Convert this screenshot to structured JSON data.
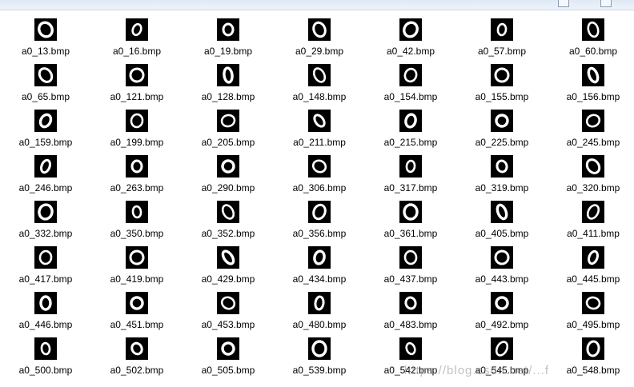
{
  "window": {
    "accent": "#dfe9f5",
    "background": "#ffffff"
  },
  "files": [
    "a0_13.bmp",
    "a0_16.bmp",
    "a0_19.bmp",
    "a0_29.bmp",
    "a0_42.bmp",
    "a0_57.bmp",
    "a0_60.bmp",
    "a0_65.bmp",
    "a0_121.bmp",
    "a0_128.bmp",
    "a0_148.bmp",
    "a0_154.bmp",
    "a0_155.bmp",
    "a0_156.bmp",
    "a0_159.bmp",
    "a0_199.bmp",
    "a0_205.bmp",
    "a0_211.bmp",
    "a0_215.bmp",
    "a0_225.bmp",
    "a0_245.bmp",
    "a0_246.bmp",
    "a0_263.bmp",
    "a0_290.bmp",
    "a0_306.bmp",
    "a0_317.bmp",
    "a0_319.bmp",
    "a0_320.bmp",
    "a0_332.bmp",
    "a0_350.bmp",
    "a0_352.bmp",
    "a0_356.bmp",
    "a0_361.bmp",
    "a0_405.bmp",
    "a0_411.bmp",
    "a0_417.bmp",
    "a0_419.bmp",
    "a0_429.bmp",
    "a0_434.bmp",
    "a0_437.bmp",
    "a0_443.bmp",
    "a0_445.bmp",
    "a0_446.bmp",
    "a0_451.bmp",
    "a0_453.bmp",
    "a0_480.bmp",
    "a0_483.bmp",
    "a0_492.bmp",
    "a0_495.bmp",
    "a0_500.bmp",
    "a0_502.bmp",
    "a0_505.bmp",
    "a0_539.bmp",
    "a0_542.bmp",
    "a0_545.bmp",
    "a0_548.bmp"
  ],
  "thumbnail_icon": "handwritten-zero-icon",
  "watermark": "https://blog.csdn.net/...f"
}
